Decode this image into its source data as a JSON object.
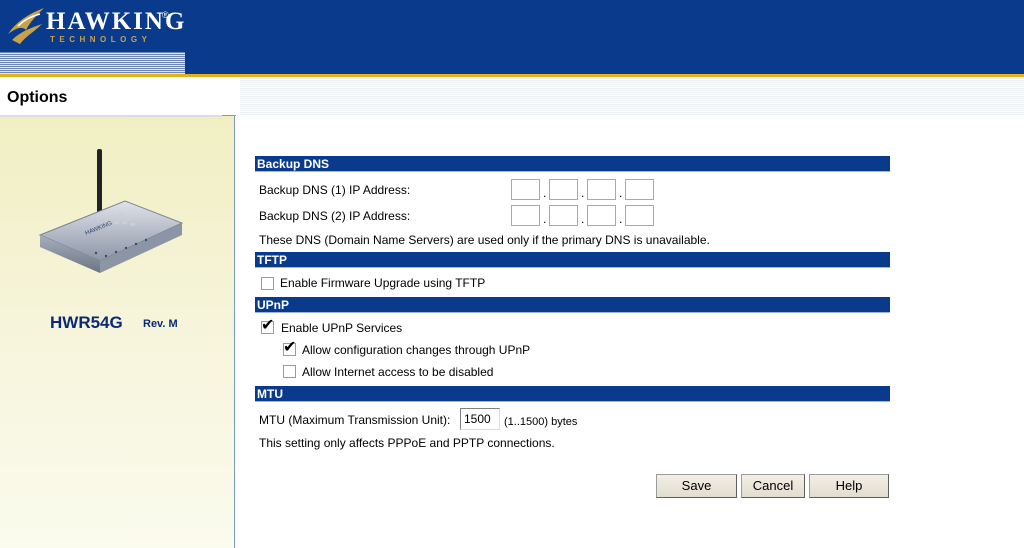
{
  "header": {
    "brand": "HAWKING",
    "trademark": "®",
    "tagline": "TECHNOLOGY"
  },
  "page_title": "Options",
  "device": {
    "model": "HWR54G",
    "revision": "Rev. M"
  },
  "backup_dns": {
    "section_title": "Backup DNS",
    "dns1_label": "Backup DNS (1) IP Address:",
    "dns1_octets": [
      "",
      "",
      "",
      ""
    ],
    "dns2_label": "Backup DNS (2) IP Address:",
    "dns2_octets": [
      "",
      "",
      "",
      ""
    ],
    "separator": ".",
    "note": "These DNS (Domain Name Servers) are used only if the primary DNS is unavailable."
  },
  "tftp": {
    "section_title": "TFTP",
    "enable_label": "Enable Firmware Upgrade using TFTP",
    "enable_checked": false
  },
  "upnp": {
    "section_title": "UPnP",
    "enable_label": "Enable UPnP Services",
    "enable_checked": true,
    "allow_config_label": "Allow configuration changes through UPnP",
    "allow_config_checked": true,
    "allow_disable_label": "Allow Internet access to be disabled",
    "allow_disable_checked": false
  },
  "mtu": {
    "section_title": "MTU",
    "label": "MTU (Maximum Transmission Unit):",
    "value": "1500",
    "range_text": "(1..1500) bytes",
    "note": "This setting only affects PPPoE and PPTP connections."
  },
  "buttons": {
    "save": "Save",
    "cancel": "Cancel",
    "help": "Help"
  },
  "colors": {
    "header_blue": "#0a3a8c",
    "accent_gold": "#e3b11e",
    "section_bar": "#0a3a8c",
    "model_text": "#0b2a73"
  }
}
